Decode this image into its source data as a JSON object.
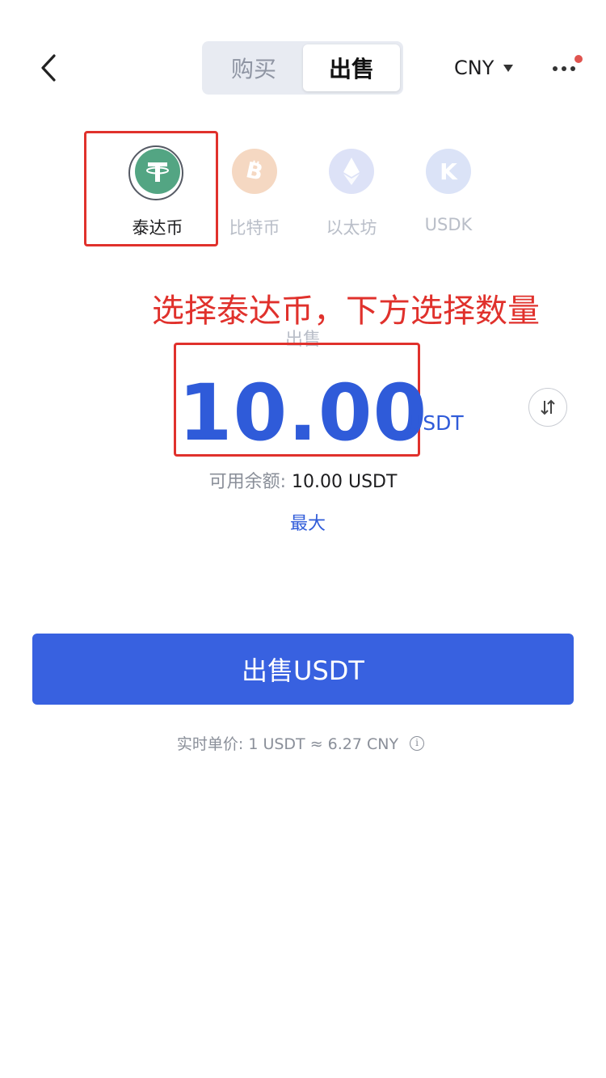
{
  "header": {
    "tabs": [
      {
        "label": "购买",
        "active": false
      },
      {
        "label": "出售",
        "active": true
      }
    ],
    "currency": "CNY",
    "back_icon": "chevron-left-icon",
    "more_icon": "more-horizontal-icon"
  },
  "coins": [
    {
      "symbol": "T",
      "label": "泰达币",
      "color": "#53a583",
      "selected": true
    },
    {
      "symbol": "B",
      "label": "比特币",
      "color": "#f5d8c2",
      "selected": false
    },
    {
      "symbol": "Ξ",
      "label": "以太坊",
      "color": "#dde2f7",
      "selected": false
    },
    {
      "symbol": "K",
      "label": "USDK",
      "color": "#dbe3f7",
      "selected": false
    }
  ],
  "annotation": "选择泰达币，下方选择数量",
  "form": {
    "caption": "出售",
    "amount": "10.00",
    "unit": "USDT",
    "balance_label": "可用余额:",
    "balance_value": "10.00 USDT",
    "max_label": "最大"
  },
  "submit_label": "出售USDT",
  "price_text": "实时单价: 1 USDT ≈ 6.27 CNY",
  "colors": {
    "accent": "#3861e0",
    "amount": "#2f5bd9",
    "annotation_red": "#e0312c",
    "notification": "#e0544f"
  }
}
